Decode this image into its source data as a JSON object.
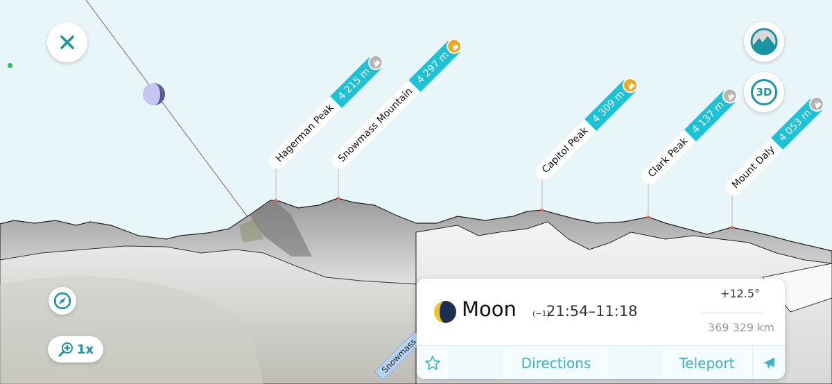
{
  "controls": {
    "close_icon": "close-icon",
    "map_mode_icon": "mountain-map-icon",
    "view_3d_label": "3D",
    "compass_icon": "compass-icon",
    "zoom_icon": "zoom-in-icon",
    "zoom_level": "1x"
  },
  "peaks": [
    {
      "name": "Hagerman Peak",
      "elevation": "4 215 m",
      "badge": "gray"
    },
    {
      "name": "Snowmass Mountain",
      "elevation": "4 297 m",
      "badge": "orange"
    },
    {
      "name": "Capitol Peak",
      "elevation": "4 309 m",
      "badge": "orange"
    },
    {
      "name": "Clark Peak",
      "elevation": "4 137 m",
      "badge": "gray"
    },
    {
      "name": "Mount Daly",
      "elevation": "4 053 m",
      "badge": "gray"
    }
  ],
  "road_label": "Snowmass",
  "info_card": {
    "object_name": "Moon",
    "day_offset": "(−1)",
    "times": "21:54–11:18",
    "altitude": "+12.5°",
    "distance": "369 329 km",
    "actions": {
      "favorite_icon": "star-icon",
      "directions": "Directions",
      "teleport": "Teleport",
      "teleport_icon": "airplane-icon"
    }
  },
  "colors": {
    "sky": "#e9f6f9",
    "accent": "#1795a3",
    "elevation_tag": "#1cc2d6",
    "badge_orange": "#f2a81d",
    "badge_gray": "#b5b5b5",
    "moon_trail": "#7a5c8a"
  }
}
